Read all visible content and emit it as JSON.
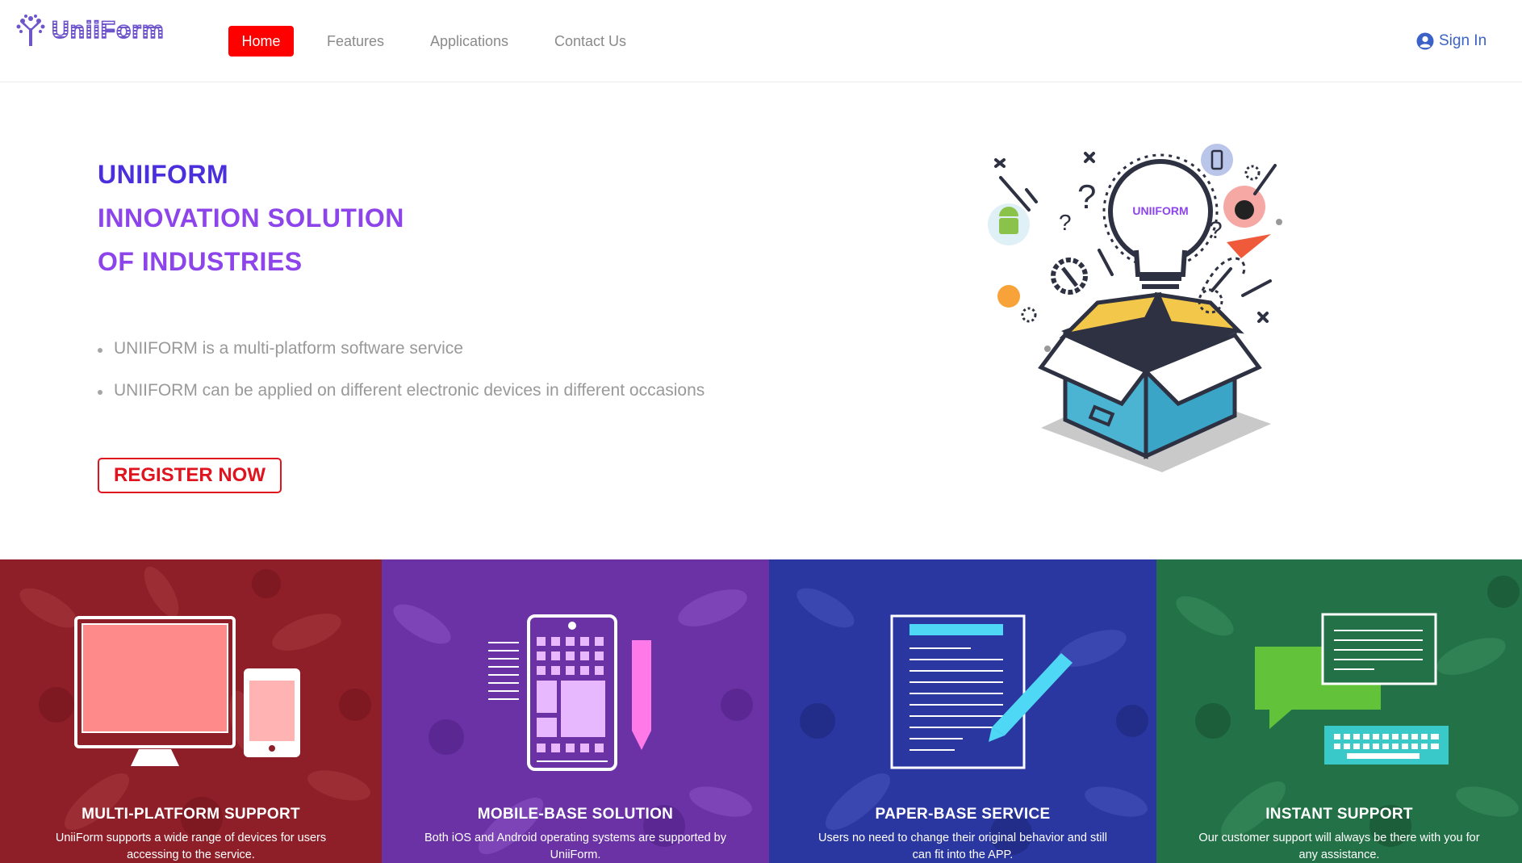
{
  "brand": {
    "name": "UniiForm",
    "logo_icon": "tree-icon"
  },
  "nav": {
    "items": [
      {
        "label": "Home",
        "active": true
      },
      {
        "label": "Features",
        "active": false
      },
      {
        "label": "Applications",
        "active": false
      },
      {
        "label": "Contact Us",
        "active": false
      }
    ],
    "signin_label": "Sign In",
    "signin_icon": "user-circle-icon"
  },
  "hero": {
    "title_lines": [
      "UNIIFORM",
      "INNOVATION SOLUTION",
      "OF INDUSTRIES"
    ],
    "bullets": [
      "UNIIFORM is a multi-platform software service",
      "UNIIFORM can be applied on different electronic devices in different occasions"
    ],
    "cta_label": "REGISTER NOW",
    "illustration_label": "UNIIFORM"
  },
  "features": [
    {
      "title": "MULTI-PLATFORM SUPPORT",
      "desc": "UniiForm supports a wide range of devices for users accessing to the service.",
      "icon": "monitor-tablet-icon"
    },
    {
      "title": "MOBILE-BASE SOLUTION",
      "desc": "Both iOS and Android operating systems are supported by UniiForm.",
      "icon": "mobile-app-icon"
    },
    {
      "title": "PAPER-BASE SERVICE",
      "desc": "Users no need to change their original behavior and still can fit into the APP.",
      "icon": "document-pen-icon"
    },
    {
      "title": "INSTANT SUPPORT",
      "desc": "Our customer support will always be there with you for any assistance.",
      "icon": "chat-keyboard-icon"
    }
  ],
  "colors": {
    "nav_active": "#fe0000",
    "hero_title_primary": "#4a2fdc",
    "hero_title_secondary": "#8d44ea",
    "cta": "#e0141e",
    "card1": "#8e1f28",
    "card2": "#6b32a6",
    "card3": "#2b37a0",
    "card4": "#237247"
  }
}
